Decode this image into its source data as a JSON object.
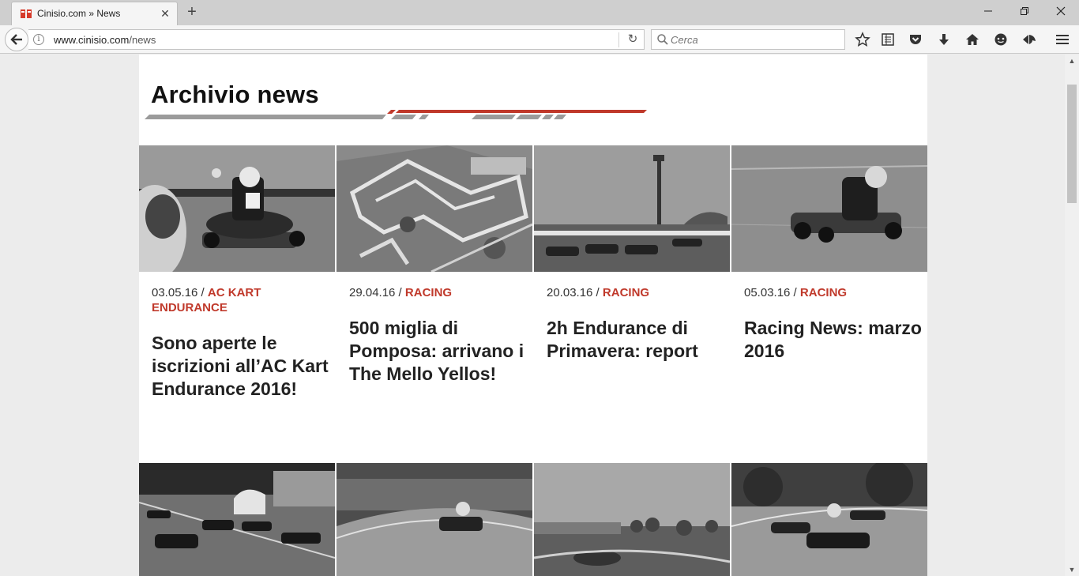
{
  "browser": {
    "tab_title": "Cinisio.com » News",
    "url_domain": "www.cinisio.com",
    "url_path": "/news",
    "search_placeholder": "Cerca",
    "window_controls": [
      "minimize-icon",
      "restore-icon",
      "close-icon"
    ],
    "toolbar_icons": [
      "bookmark-star-icon",
      "reader-view-icon",
      "pocket-icon",
      "download-icon",
      "home-icon",
      "chat-icon",
      "share-icon",
      "menu-icon"
    ]
  },
  "page": {
    "heading": "Archivio news",
    "accent_color": "#c0392b",
    "articles": [
      {
        "date": "03.05.16",
        "separator": " / ",
        "category": "AC KART ENDURANCE",
        "title": "Sono aperte le iscrizioni all’AC Kart Endurance 2016!"
      },
      {
        "date": "29.04.16",
        "separator": " / ",
        "category": "RACING",
        "title": "500 miglia di Pomposa: arrivano i The Mello Yellos!"
      },
      {
        "date": "20.03.16",
        "separator": " / ",
        "category": "RACING",
        "title": "2h Endurance di Primavera: report"
      },
      {
        "date": "05.03.16",
        "separator": " / ",
        "category": "RACING",
        "title": "Racing News: marzo 2016"
      }
    ]
  }
}
